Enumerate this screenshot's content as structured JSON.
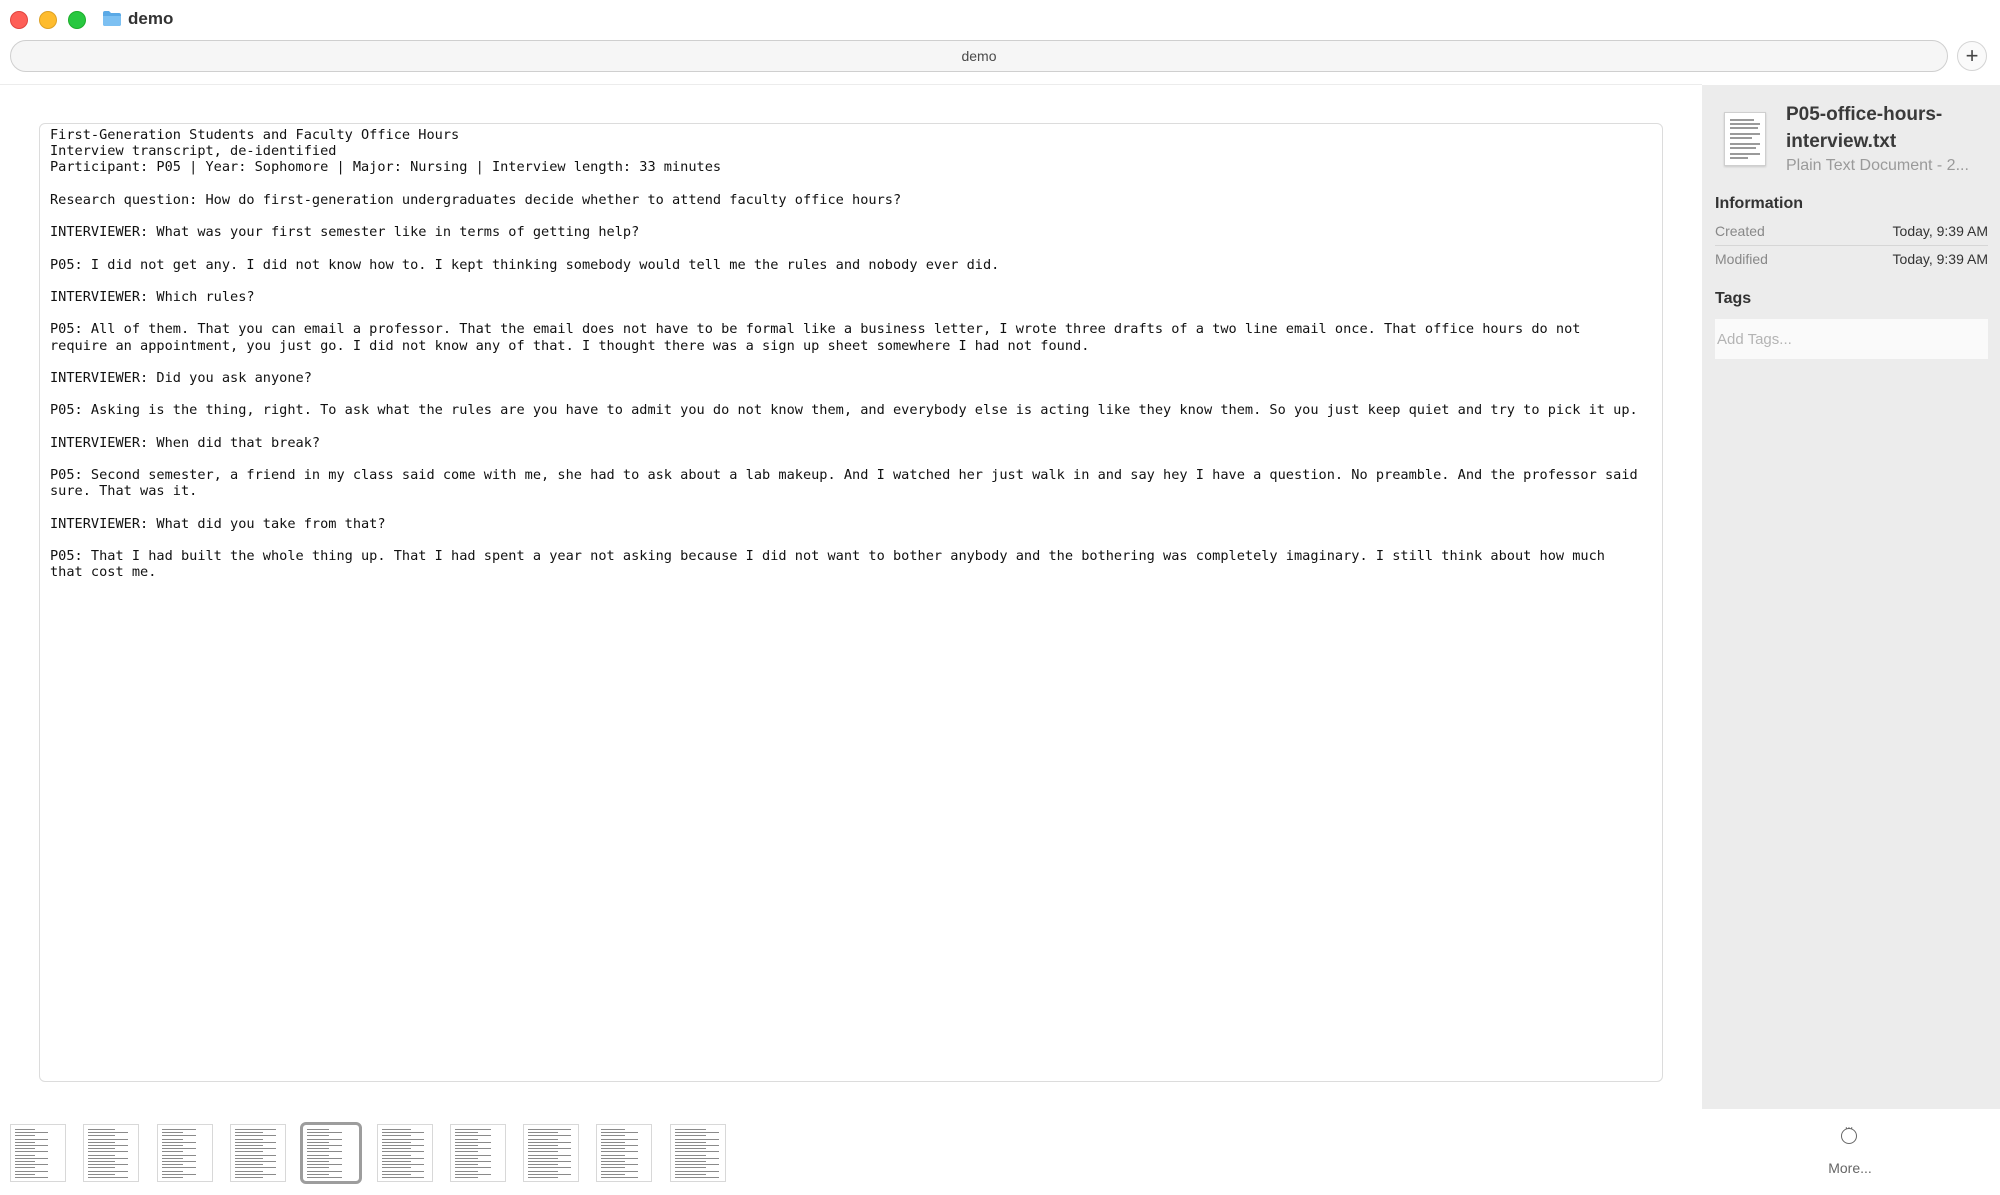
{
  "window": {
    "title": "demo",
    "path_bar": "demo",
    "new_tab_label": "+"
  },
  "document": {
    "lines": [
      "First-Generation Students and Faculty Office Hours",
      "Interview transcript, de-identified",
      "Participant: P05 | Year: Sophomore | Major: Nursing | Interview length: 33 minutes",
      "",
      "Research question: How do first-generation undergraduates decide whether to attend faculty office hours?",
      "",
      "INTERVIEWER: What was your first semester like in terms of getting help?",
      "",
      "P05: I did not get any. I did not know how to. I kept thinking somebody would tell me the rules and nobody ever did.",
      "",
      "INTERVIEWER: Which rules?",
      "",
      "P05: All of them. That you can email a professor. That the email does not have to be formal like a business letter, I wrote three drafts of a two line email once. That office hours do not",
      "require an appointment, you just go. I did not know any of that. I thought there was a sign up sheet somewhere I had not found.",
      "",
      "INTERVIEWER: Did you ask anyone?",
      "",
      "P05: Asking is the thing, right. To ask what the rules are you have to admit you do not know them, and everybody else is acting like they know them. So you just keep quiet and try to pick it up.",
      "",
      "INTERVIEWER: When did that break?",
      "",
      "P05: Second semester, a friend in my class said come with me, she had to ask about a lab makeup. And I watched her just walk in and say hey I have a question. No preamble. And the professor said",
      "sure. That was it.",
      "",
      "INTERVIEWER: What did you take from that?",
      "",
      "P05: That I had built the whole thing up. That I had spent a year not asking because I did not want to bother anybody and the bothering was completely imaginary. I still think about how much",
      "that cost me."
    ]
  },
  "inspector": {
    "file_name": "P05-office-hours-interview.txt",
    "file_kind": "Plain Text Document - 2...",
    "information_heading": "Information",
    "created_label": "Created",
    "created_value": "Today, 9:39 AM",
    "modified_label": "Modified",
    "modified_value": "Today, 9:39 AM",
    "tags_heading": "Tags",
    "tags_placeholder": "Add Tags..."
  },
  "thumbnails": {
    "count": 10,
    "selected_index": 4
  },
  "more_button": {
    "label": "More..."
  },
  "colors": {
    "close": "#fe5f57",
    "minimize": "#febc2e",
    "maximize": "#28c840",
    "sidebar_bg": "#ececec",
    "folder": "#5aa9e6"
  }
}
